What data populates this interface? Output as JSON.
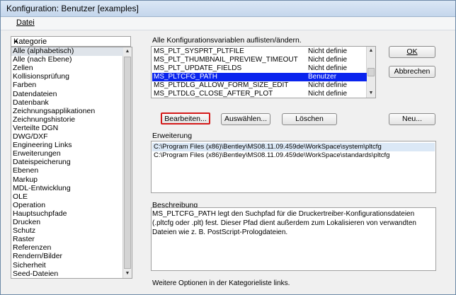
{
  "window": {
    "title": "Konfiguration: Benutzer [examples]"
  },
  "menu": {
    "datei": "Datei"
  },
  "category_panel": {
    "header": "Kategorie",
    "items": [
      "Alle (alphabetisch)",
      "Alle (nach Ebene)",
      "Zellen",
      "Kollisionsprüfung",
      "Farben",
      "Datendateien",
      "Datenbank",
      "Zeichnungsapplikationen",
      "Zeichnungshistorie",
      "Verteilte DGN",
      "DWG/DXF",
      "Engineering Links",
      "Erweiterungen",
      "Dateispeicherung",
      "Ebenen",
      "Markup",
      "MDL-Entwicklung",
      "OLE",
      "Operation",
      "Hauptsuchpfade",
      "Drucken",
      "Schutz",
      "Raster",
      "Referenzen",
      "Rendern/Bilder",
      "Sicherheit",
      "Seed-Dateien"
    ],
    "selected_index": 0
  },
  "variables": {
    "caption": "Alle Konfigurationsvariablen auflisten/ändern.",
    "rows": [
      {
        "name": "MS_PLT_SYSPRT_PLTFILE",
        "level": "Nicht definie"
      },
      {
        "name": "MS_PLT_THUMBNAIL_PREVIEW_TIMEOUT",
        "level": "Nicht definie"
      },
      {
        "name": "MS_PLT_UPDATE_FIELDS",
        "level": "Nicht definie"
      },
      {
        "name": "MS_PLTCFG_PATH",
        "level": "Benutzer"
      },
      {
        "name": "MS_PLTDLG_ALLOW_FORM_SIZE_EDIT",
        "level": "Nicht definie"
      },
      {
        "name": "MS_PLTDLG_CLOSE_AFTER_PLOT",
        "level": "Nicht definie"
      }
    ],
    "selected_index": 3
  },
  "buttons": {
    "ok": "OK",
    "abbrechen": "Abbrechen",
    "bearbeiten": "Bearbeiten...",
    "auswaehlen": "Auswählen...",
    "loeschen": "Löschen",
    "neu": "Neu..."
  },
  "erweiterung": {
    "label": "Erweiterung",
    "paths": [
      "C:\\Program Files (x86)\\Bentley\\MS08.11.09.459de\\WorkSpace\\system\\pltcfg",
      "C:\\Program Files (x86)\\Bentley\\MS08.11.09.459de\\WorkSpace\\standards\\pltcfg"
    ]
  },
  "beschreibung": {
    "label": "Beschreibung",
    "text": "MS_PLTCFG_PATH legt den Suchpfad für die Druckertreiber-Konfigurationsdateien (.pltcfg oder .plt) fest. Dieser Pfad dient außerdem zum Lokalisieren von verwandten Dateien wie z. B. PostScript-Prologdateien."
  },
  "footer": "Weitere Optionen in der Kategorieliste links.",
  "colors": {
    "selection": "#0a24ee",
    "highlight_border": "#d41a1a"
  },
  "icons": {
    "scroll_up": "scroll-up-arrow-icon",
    "scroll_down": "scroll-down-arrow-icon"
  }
}
